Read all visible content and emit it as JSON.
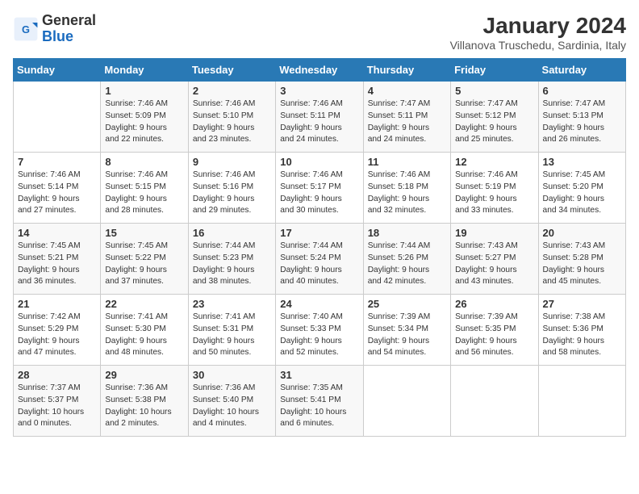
{
  "header": {
    "logo_general": "General",
    "logo_blue": "Blue",
    "title": "January 2024",
    "subtitle": "Villanova Truschedu, Sardinia, Italy"
  },
  "days_of_week": [
    "Sunday",
    "Monday",
    "Tuesday",
    "Wednesday",
    "Thursday",
    "Friday",
    "Saturday"
  ],
  "weeks": [
    [
      {
        "day": "",
        "info": ""
      },
      {
        "day": "1",
        "info": "Sunrise: 7:46 AM\nSunset: 5:09 PM\nDaylight: 9 hours\nand 22 minutes."
      },
      {
        "day": "2",
        "info": "Sunrise: 7:46 AM\nSunset: 5:10 PM\nDaylight: 9 hours\nand 23 minutes."
      },
      {
        "day": "3",
        "info": "Sunrise: 7:46 AM\nSunset: 5:11 PM\nDaylight: 9 hours\nand 24 minutes."
      },
      {
        "day": "4",
        "info": "Sunrise: 7:47 AM\nSunset: 5:11 PM\nDaylight: 9 hours\nand 24 minutes."
      },
      {
        "day": "5",
        "info": "Sunrise: 7:47 AM\nSunset: 5:12 PM\nDaylight: 9 hours\nand 25 minutes."
      },
      {
        "day": "6",
        "info": "Sunrise: 7:47 AM\nSunset: 5:13 PM\nDaylight: 9 hours\nand 26 minutes."
      }
    ],
    [
      {
        "day": "7",
        "info": "Sunrise: 7:46 AM\nSunset: 5:14 PM\nDaylight: 9 hours\nand 27 minutes."
      },
      {
        "day": "8",
        "info": "Sunrise: 7:46 AM\nSunset: 5:15 PM\nDaylight: 9 hours\nand 28 minutes."
      },
      {
        "day": "9",
        "info": "Sunrise: 7:46 AM\nSunset: 5:16 PM\nDaylight: 9 hours\nand 29 minutes."
      },
      {
        "day": "10",
        "info": "Sunrise: 7:46 AM\nSunset: 5:17 PM\nDaylight: 9 hours\nand 30 minutes."
      },
      {
        "day": "11",
        "info": "Sunrise: 7:46 AM\nSunset: 5:18 PM\nDaylight: 9 hours\nand 32 minutes."
      },
      {
        "day": "12",
        "info": "Sunrise: 7:46 AM\nSunset: 5:19 PM\nDaylight: 9 hours\nand 33 minutes."
      },
      {
        "day": "13",
        "info": "Sunrise: 7:45 AM\nSunset: 5:20 PM\nDaylight: 9 hours\nand 34 minutes."
      }
    ],
    [
      {
        "day": "14",
        "info": "Sunrise: 7:45 AM\nSunset: 5:21 PM\nDaylight: 9 hours\nand 36 minutes."
      },
      {
        "day": "15",
        "info": "Sunrise: 7:45 AM\nSunset: 5:22 PM\nDaylight: 9 hours\nand 37 minutes."
      },
      {
        "day": "16",
        "info": "Sunrise: 7:44 AM\nSunset: 5:23 PM\nDaylight: 9 hours\nand 38 minutes."
      },
      {
        "day": "17",
        "info": "Sunrise: 7:44 AM\nSunset: 5:24 PM\nDaylight: 9 hours\nand 40 minutes."
      },
      {
        "day": "18",
        "info": "Sunrise: 7:44 AM\nSunset: 5:26 PM\nDaylight: 9 hours\nand 42 minutes."
      },
      {
        "day": "19",
        "info": "Sunrise: 7:43 AM\nSunset: 5:27 PM\nDaylight: 9 hours\nand 43 minutes."
      },
      {
        "day": "20",
        "info": "Sunrise: 7:43 AM\nSunset: 5:28 PM\nDaylight: 9 hours\nand 45 minutes."
      }
    ],
    [
      {
        "day": "21",
        "info": "Sunrise: 7:42 AM\nSunset: 5:29 PM\nDaylight: 9 hours\nand 47 minutes."
      },
      {
        "day": "22",
        "info": "Sunrise: 7:41 AM\nSunset: 5:30 PM\nDaylight: 9 hours\nand 48 minutes."
      },
      {
        "day": "23",
        "info": "Sunrise: 7:41 AM\nSunset: 5:31 PM\nDaylight: 9 hours\nand 50 minutes."
      },
      {
        "day": "24",
        "info": "Sunrise: 7:40 AM\nSunset: 5:33 PM\nDaylight: 9 hours\nand 52 minutes."
      },
      {
        "day": "25",
        "info": "Sunrise: 7:39 AM\nSunset: 5:34 PM\nDaylight: 9 hours\nand 54 minutes."
      },
      {
        "day": "26",
        "info": "Sunrise: 7:39 AM\nSunset: 5:35 PM\nDaylight: 9 hours\nand 56 minutes."
      },
      {
        "day": "27",
        "info": "Sunrise: 7:38 AM\nSunset: 5:36 PM\nDaylight: 9 hours\nand 58 minutes."
      }
    ],
    [
      {
        "day": "28",
        "info": "Sunrise: 7:37 AM\nSunset: 5:37 PM\nDaylight: 10 hours\nand 0 minutes."
      },
      {
        "day": "29",
        "info": "Sunrise: 7:36 AM\nSunset: 5:38 PM\nDaylight: 10 hours\nand 2 minutes."
      },
      {
        "day": "30",
        "info": "Sunrise: 7:36 AM\nSunset: 5:40 PM\nDaylight: 10 hours\nand 4 minutes."
      },
      {
        "day": "31",
        "info": "Sunrise: 7:35 AM\nSunset: 5:41 PM\nDaylight: 10 hours\nand 6 minutes."
      },
      {
        "day": "",
        "info": ""
      },
      {
        "day": "",
        "info": ""
      },
      {
        "day": "",
        "info": ""
      }
    ]
  ]
}
